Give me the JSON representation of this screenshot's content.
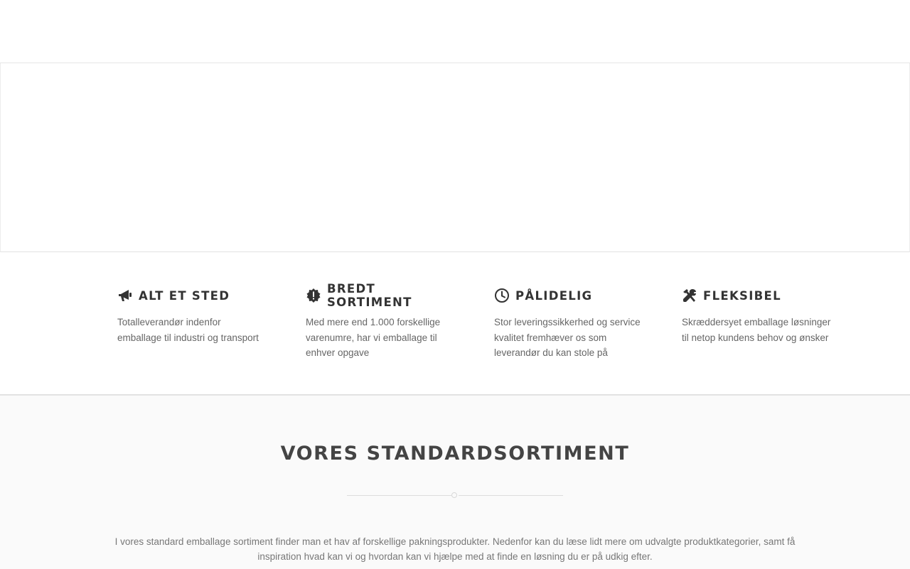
{
  "features": [
    {
      "icon": "megaphone-icon",
      "title": "ALT ET STED",
      "text": "Totalleverandør indenfor emballage til industri og transport"
    },
    {
      "icon": "certificate-exclamation-icon",
      "title": "BREDT SORTIMENT",
      "text": "Med mere end 1.000 forskellige varenumre, har vi emballage til enhver opgave"
    },
    {
      "icon": "clock-icon",
      "title": "PÅLIDELIG",
      "text": "Stor leveringssikkerhed og service kvalitet fremhæver os som leverandør du kan stole på"
    },
    {
      "icon": "tools-icon",
      "title": "FLEKSIBEL",
      "text": "Skræddersyet emballage løsninger til netop kundens behov og ønsker"
    }
  ],
  "sortiment": {
    "title": "VORES STANDARDSORTIMENT",
    "text": "I vores standard emballage sortiment finder man et hav af forskellige pakningsprodukter. Nedenfor kan du læse lidt mere om udvalgte produktkategorier, samt få inspiration hvad kan vi og hvordan kan vi hjælpe med at finde en løsning du er på udkig efter."
  },
  "colors": {
    "heading": "#333333",
    "body_text": "#666666",
    "section_bg": "#fafafa"
  }
}
